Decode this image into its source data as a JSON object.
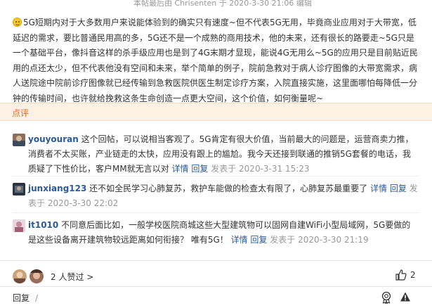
{
  "edit_note": "本帖最后由 Chrisenten 于 2020-3-30 21:06 编辑",
  "post": {
    "body": "5G短期内对于大多数用户来说能体验到的确实只有速度~但不代表5G无用，毕竟商业应用对于大带宽，低延迟的需求，要比普通民用高的多，5G还不是一个成熟的商用技术，他的未来，还有很长的路要走~5G只是一个基础平台，像抖音这样的杀手级应用也是到了4G末期才显现，能说4G无用么~5G的应用只是目前贴近民用的点还太少，但不代表他没有空间和未来，举个简单的例子，院前急救对于病人诊疗图像的大带宽需求，病人送院途中院前诊疗图像就已经传输到急救医院供医生制定诊疗方案，入院直接实施，这里面哪怕每降低一分钟的传输时间，也许就给挽救这条生命创造一点更大空间，这个价值，如何衡量呢~"
  },
  "section_label": "点评",
  "comments": [
    {
      "user": "youyouran",
      "text": " 这个回帖，可以说相当客观了。5G肯定有很大价值，当前最大的问题是，运营商卖力推，消费者不太买账，产业链走的太快，应用没有跟上的尴尬。我今天还接到联通的推销5G套餐的电话，我质疑了下性价比，客户MM就无言以对 ",
      "detail": "详情",
      "reply": "回复",
      "time": "发表于 2020-3-31 15:23"
    },
    {
      "user": "junxiang123",
      "text": " 还不如全民学习心肺复苏，救护车能做的检查太有限了，心肺复苏最重要了 ",
      "detail": "详情",
      "reply": "回复",
      "time": "发表于 2020-3-30 22:02"
    },
    {
      "user": "it1010",
      "text": " 不同意后面比如，一般学校医院商城这些大型建筑物可以固网自建WiFi小型局域网，5G要做的是这些设备离开建筑物较远距离如何衔接？ 唯有5G！ ",
      "detail": "详情",
      "reply": "回复",
      "time": "发表于 2020-3-30 21:19"
    }
  ],
  "footer": {
    "likers_text": "2 人赞过 >",
    "like_count": "2",
    "reply_label": "回复",
    "reply_sep": "/"
  },
  "icons": [
    "smiley-icon",
    "thumbs-up-icon",
    "award-icon",
    "warning-icon"
  ],
  "colors": {
    "username": "#2a5a9a",
    "section_bg": "#fdf1e4",
    "section_text": "#e56a1f"
  }
}
